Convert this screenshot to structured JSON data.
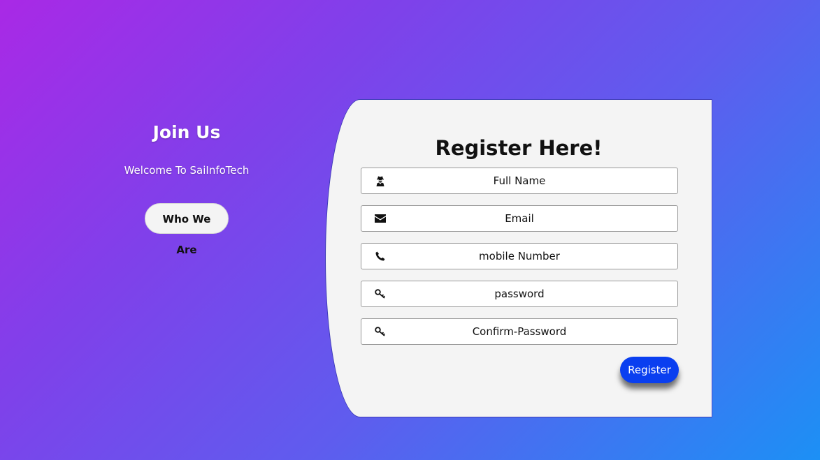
{
  "left": {
    "title": "Join Us",
    "welcome": "Welcome To SaiInfoTech",
    "button_label": "Who We Are"
  },
  "form": {
    "title": "Register Here!",
    "fields": [
      {
        "placeholder": "Full Name",
        "icon": "user-secret-icon"
      },
      {
        "placeholder": "Email",
        "icon": "envelope-icon"
      },
      {
        "placeholder": "mobile Number",
        "icon": "phone-icon"
      },
      {
        "placeholder": "password",
        "icon": "key-icon"
      },
      {
        "placeholder": "Confirm-Password",
        "icon": "key-icon"
      }
    ],
    "submit_label": "Register"
  },
  "colors": {
    "gradient_start": "#a929e6",
    "gradient_end": "#1c90f5",
    "card_background": "#f4f4f4",
    "register_button": "#0a3ff0"
  }
}
